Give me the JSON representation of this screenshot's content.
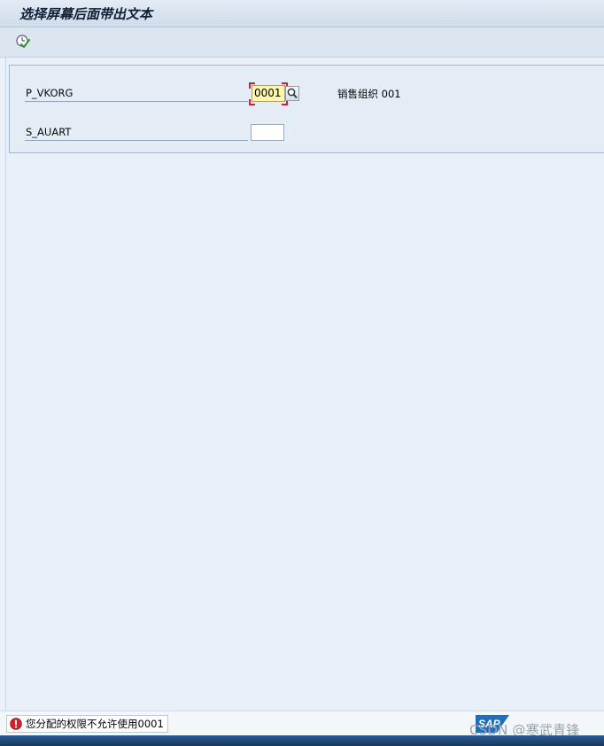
{
  "window": {
    "title": "选择屏幕后面带出文本"
  },
  "toolbar": {
    "execute_icon": "execute-clock-check-icon"
  },
  "selection": {
    "fields": [
      {
        "name": "P_VKORG",
        "value": "0001",
        "state": "error",
        "value_help_icon": "magnifier-icon",
        "description": "销售组织 001"
      },
      {
        "name": "S_AUART",
        "value": ""
      }
    ]
  },
  "status_bar": {
    "type": "error",
    "icon": "error-exclamation-icon",
    "message": "您分配的权限不允许使用0001"
  },
  "branding": {
    "logo": "SAP",
    "watermark": "CSDN @寒武青锋"
  },
  "colors": {
    "error_field_bg": "#fff6a8",
    "error_marker": "#d21f3c",
    "background": "#e9f0f7"
  }
}
